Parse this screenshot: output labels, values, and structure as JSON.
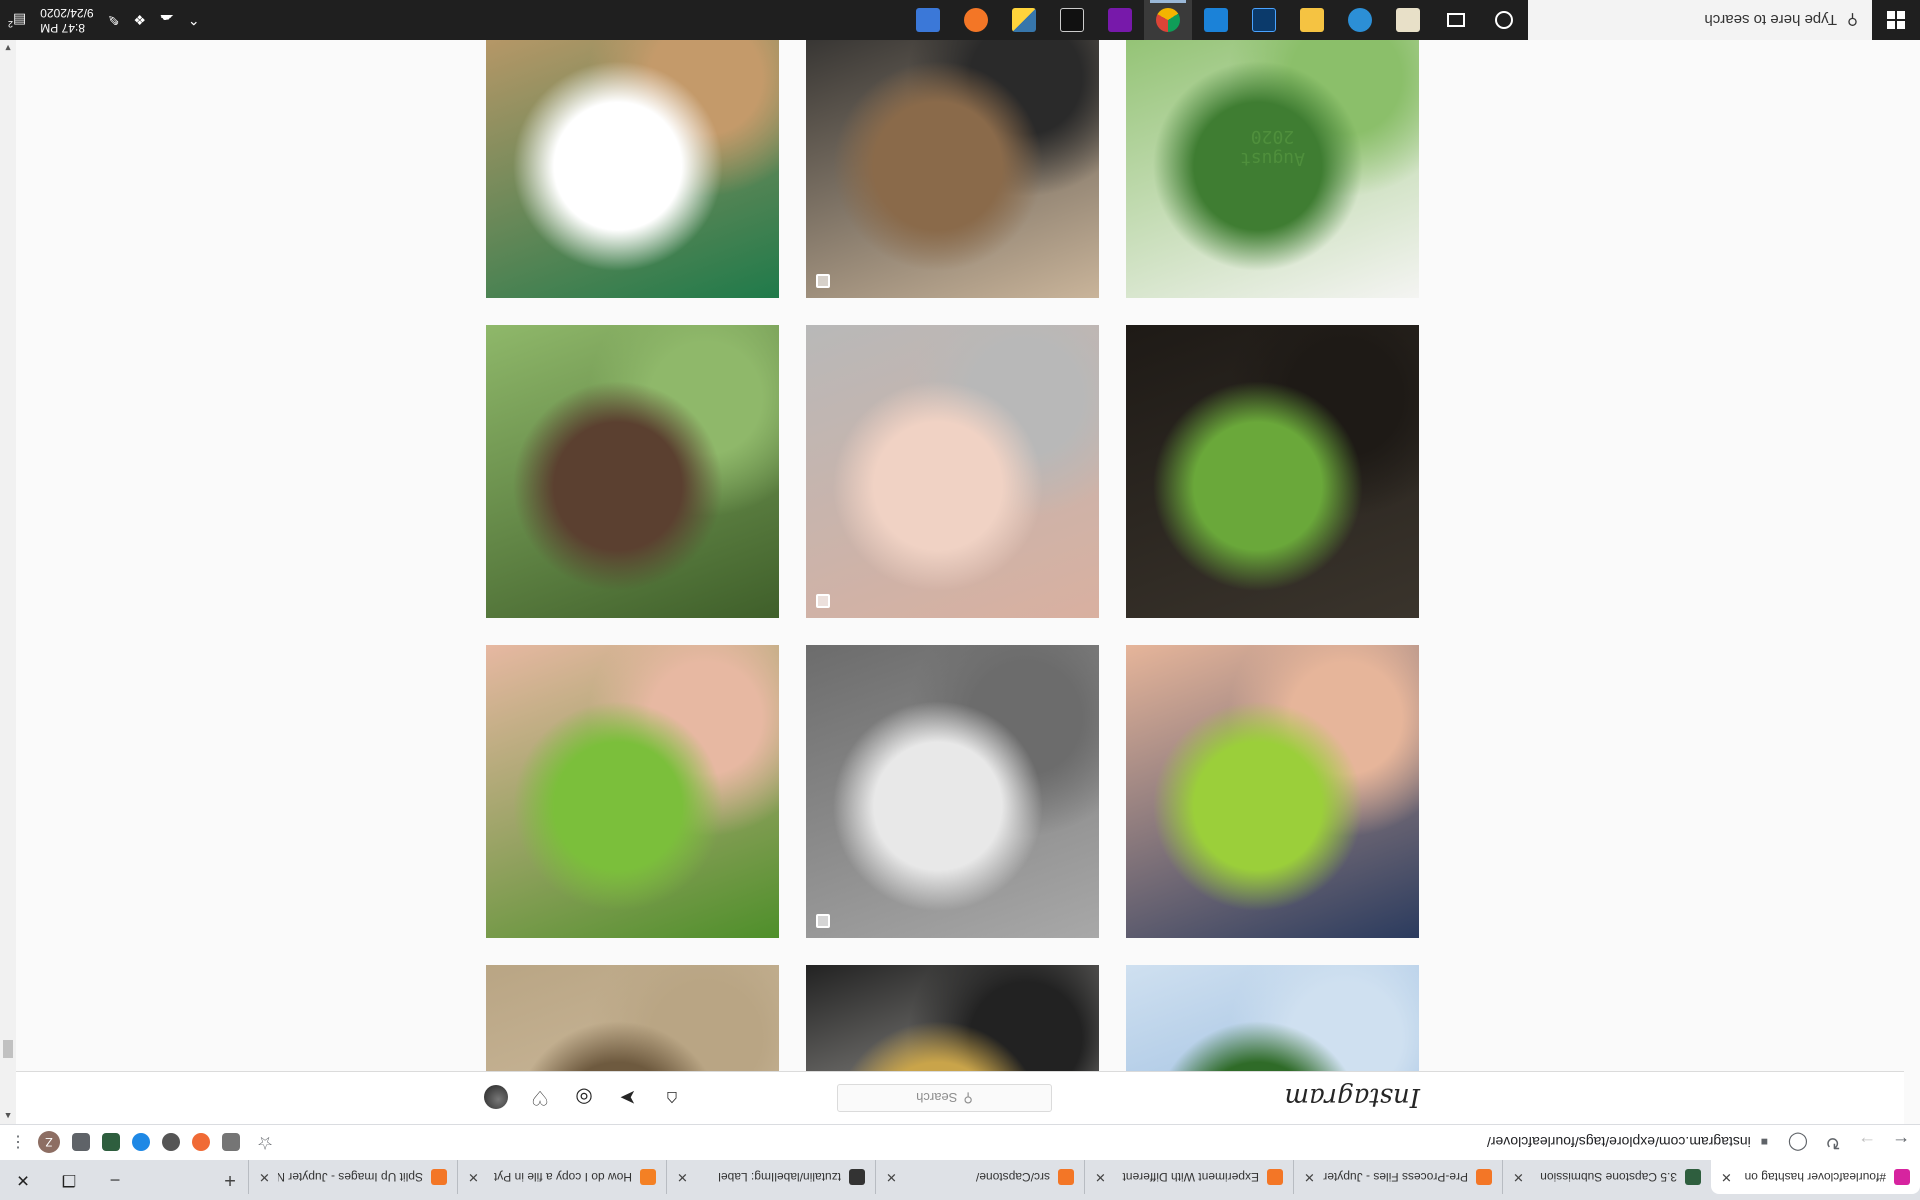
{
  "taskbar": {
    "search_placeholder": "Type here to search",
    "time": "8:47 PM",
    "date": "9/24/2020",
    "notification_count": "2",
    "pinned_apps": [
      "task-view",
      "file-explorer",
      "edge",
      "sticky-notes",
      "adobe-substance-designer",
      "photos",
      "chrome",
      "onenote",
      "terminal",
      "python",
      "jupyter",
      "excel-like"
    ]
  },
  "browser": {
    "tabs": [
      {
        "title": "#fourleafclover hashtag on",
        "favicon": "instagram",
        "color": "#d6249f",
        "active": true
      },
      {
        "title": "3.5 Capstone Submission",
        "favicon": "jupyter",
        "color": "#2e5e3e",
        "active": false
      },
      {
        "title": "Pre-Process Files - Jupyter",
        "favicon": "jupyter",
        "color": "#f37626",
        "active": false
      },
      {
        "title": "Experiment With Different",
        "favicon": "jupyter",
        "color": "#f37626",
        "active": false
      },
      {
        "title": "src/Capstone/",
        "favicon": "jupyter",
        "color": "#f37626",
        "active": false
      },
      {
        "title": "tzutalin/labelImg: Label",
        "favicon": "github",
        "color": "#333333",
        "active": false
      },
      {
        "title": "How do I copy a file in Pyt",
        "favicon": "stackoverflow",
        "color": "#f48024",
        "active": false
      },
      {
        "title": "Split Up Images - Jupyter N",
        "favicon": "jupyter",
        "color": "#f37626",
        "active": false
      }
    ],
    "url": "instagram.com/explore/tags/fourleafclover/",
    "profile_initial": "Z"
  },
  "instagram": {
    "logo": "Instagram",
    "search_placeholder": "Search",
    "nav_icons": [
      "home-icon",
      "direct-icon",
      "explore-icon",
      "activity-icon",
      "profile-avatar"
    ]
  },
  "posts": [
    {
      "label": "clover-leaves-sky",
      "multi": false,
      "colors": [
        "#7aa6d6",
        "#2f6b28",
        "#cfe0f0"
      ]
    },
    {
      "label": "cartoon-illustration",
      "multi": true,
      "colors": [
        "#f4f1ea",
        "#c9a44a",
        "#222222"
      ]
    },
    {
      "label": "clover-sand-shadow",
      "multi": false,
      "colors": [
        "#d9c8ad",
        "#6e5a3f",
        "#b9a584"
      ]
    },
    {
      "label": "hand-holding-clover-blue",
      "multi": false,
      "colors": [
        "#2b3b5e",
        "#9bcf3a",
        "#e6b59a"
      ]
    },
    {
      "label": "white-cat-figurine",
      "multi": true,
      "colors": [
        "#a8a8a8",
        "#e8e8e8",
        "#6c6c6c"
      ]
    },
    {
      "label": "hand-clover-grass",
      "multi": false,
      "colors": [
        "#4e8f2a",
        "#7bbf3b",
        "#e7b8a2"
      ]
    },
    {
      "label": "two-clovers-dark",
      "multi": false,
      "colors": [
        "#3a342c",
        "#6aa83a",
        "#1e1a16"
      ]
    },
    {
      "label": "clover-earrings-palm",
      "multi": true,
      "colors": [
        "#d9b0a0",
        "#f0d2c4",
        "#b8b8b8"
      ]
    },
    {
      "label": "bracelet-on-tree",
      "multi": false,
      "colors": [
        "#3f5f2a",
        "#5b4030",
        "#8fb86a"
      ]
    },
    {
      "label": "clover-wreath-august-2020",
      "multi": false,
      "colors": [
        "#f4f4f2",
        "#3f7d32",
        "#8bbf6a"
      ],
      "caption_line1": "August",
      "caption_line2": "2020"
    },
    {
      "label": "bubble-tea-mall",
      "multi": true,
      "colors": [
        "#c9b49a",
        "#8a6a4a",
        "#2a2a2a"
      ]
    },
    {
      "label": "shamrock-pattern-corkboard",
      "multi": false,
      "colors": [
        "#1f7a4a",
        "#ffffff",
        "#c49a6a"
      ]
    }
  ]
}
